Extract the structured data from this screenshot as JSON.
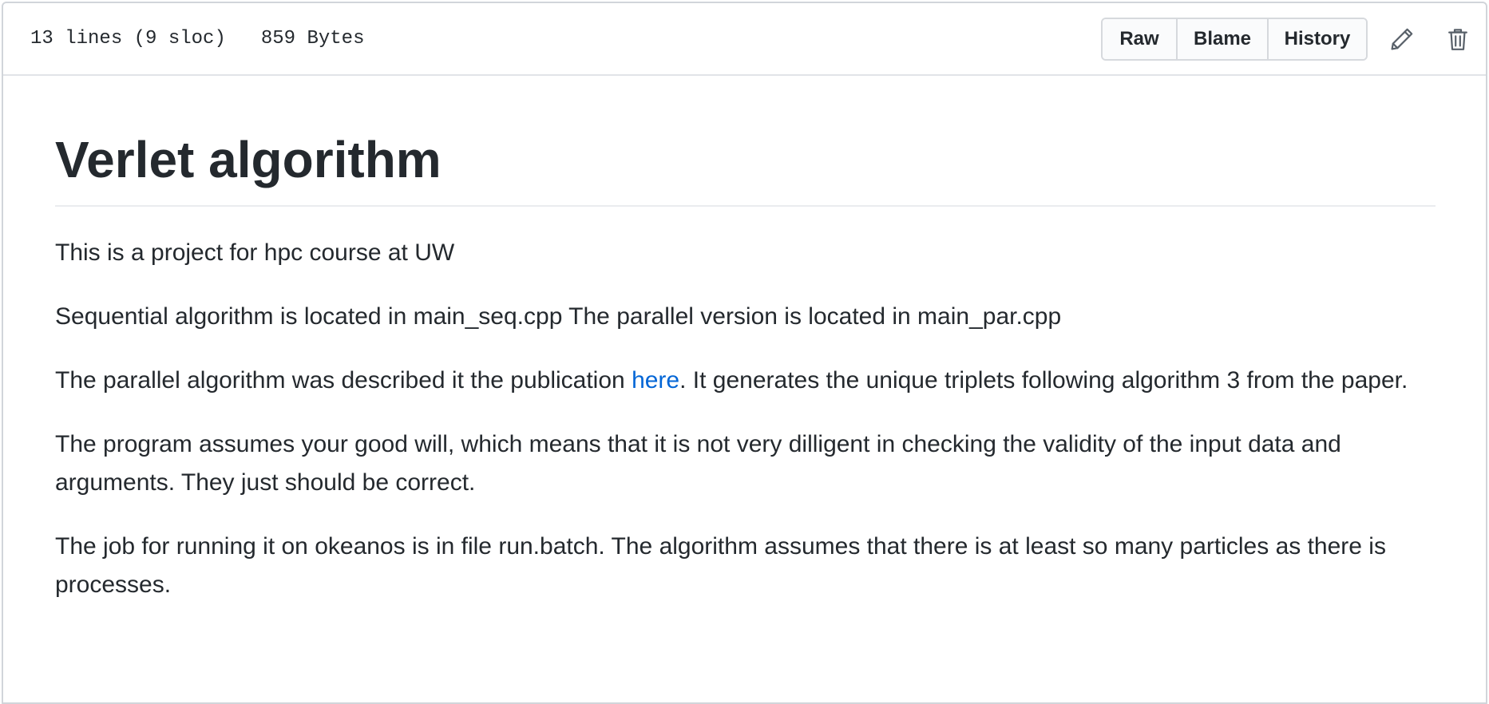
{
  "file_header": {
    "lines": "13 lines (9 sloc)",
    "size": "859 Bytes",
    "buttons": {
      "raw": "Raw",
      "blame": "Blame",
      "history": "History"
    },
    "icons": {
      "edit": "pencil-icon",
      "delete": "trash-icon"
    }
  },
  "readme": {
    "title": "Verlet algorithm",
    "paragraphs": {
      "p1": "This is a project for hpc course at UW",
      "p2": "Sequential algorithm is located in main_seq.cpp The parallel version is located in main_par.cpp",
      "p3_before": "The parallel algorithm was described it the publication ",
      "p3_link": "here",
      "p3_after": ". It generates the unique triplets following algorithm 3 from the paper.",
      "p4": "The program assumes your good will, which means that it is not very dilligent in checking the validity of the input data and arguments. They just should be correct.",
      "p5": "The job for running it on okeanos is in file run.batch. The algorithm assumes that there is at least so many particles as there is processes."
    }
  },
  "colors": {
    "link": "#0366d6",
    "text": "#24292e",
    "border": "#d1d5da",
    "icon": "#586069"
  }
}
